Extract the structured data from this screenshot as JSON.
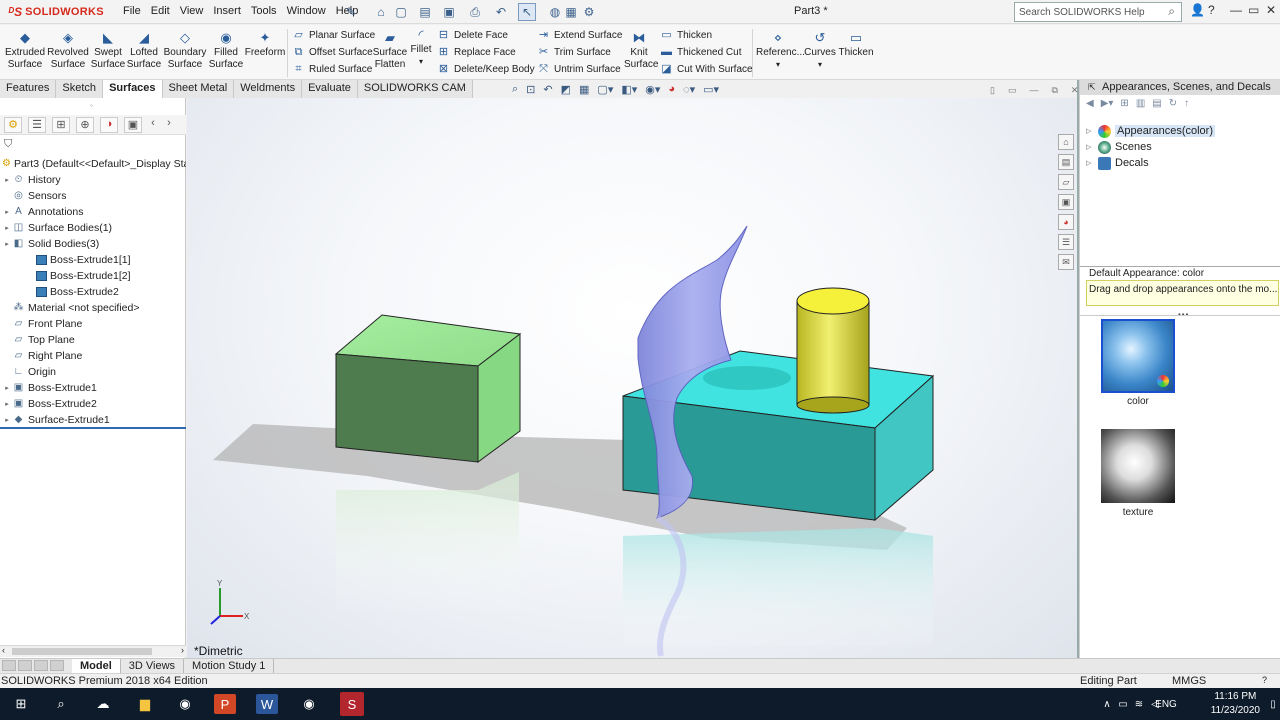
{
  "app": {
    "brand": "SOLIDWORKS",
    "document_title": "Part3 *",
    "help_search_placeholder": "Search SOLIDWORKS Help"
  },
  "menus": [
    "File",
    "Edit",
    "View",
    "Insert",
    "Tools",
    "Window",
    "Help"
  ],
  "ribbon": {
    "big_buttons": [
      {
        "l1": "Extruded",
        "l2": "Surface",
        "icon": "extruded-surface-icon"
      },
      {
        "l1": "Revolved",
        "l2": "Surface",
        "icon": "revolved-surface-icon"
      },
      {
        "l1": "Swept",
        "l2": "Surface",
        "icon": "swept-surface-icon"
      },
      {
        "l1": "Lofted",
        "l2": "Surface",
        "icon": "lofted-surface-icon"
      },
      {
        "l1": "Boundary",
        "l2": "Surface",
        "icon": "boundary-surface-icon"
      },
      {
        "l1": "Filled",
        "l2": "Surface",
        "icon": "filled-surface-icon"
      },
      {
        "l1": "Freeform",
        "l2": "",
        "icon": "freeform-icon"
      }
    ],
    "col1": [
      "Planar Surface",
      "Offset Surface",
      "Ruled Surface"
    ],
    "surface_flatten": {
      "l1": "Surface",
      "l2": "Flatten"
    },
    "fillet": "Fillet",
    "col2": [
      "Delete Face",
      "Replace Face",
      "Delete/Keep Body"
    ],
    "col3": [
      "Extend Surface",
      "Trim Surface",
      "Untrim Surface"
    ],
    "knit": {
      "l1": "Knit",
      "l2": "Surface"
    },
    "col4": [
      "Thicken",
      "Thickened Cut",
      "Cut With Surface"
    ],
    "reference": "Referenc...",
    "curves": "Curves",
    "thicken_big": "Thicken"
  },
  "tabs": [
    "Features",
    "Sketch",
    "Surfaces",
    "Sheet Metal",
    "Weldments",
    "Evaluate",
    "SOLIDWORKS CAM"
  ],
  "active_tab": "Surfaces",
  "tree": {
    "root": "Part3  (Default<<Default>_Display Sta",
    "items": [
      {
        "label": "History",
        "icon": "history-icon",
        "expand": true,
        "indent": 0
      },
      {
        "label": "Sensors",
        "icon": "sensors-icon",
        "expand": false,
        "indent": 0
      },
      {
        "label": "Annotations",
        "icon": "annotations-icon",
        "expand": true,
        "indent": 0
      },
      {
        "label": "Surface Bodies(1)",
        "icon": "surface-bodies-icon",
        "expand": true,
        "indent": 0
      },
      {
        "label": "Solid Bodies(3)",
        "icon": "solid-bodies-icon",
        "expand": true,
        "indent": 0
      },
      {
        "label": "Boss-Extrude1[1]",
        "icon": "solid-body-icon",
        "expand": false,
        "indent": 1
      },
      {
        "label": "Boss-Extrude1[2]",
        "icon": "solid-body-icon",
        "expand": false,
        "indent": 1
      },
      {
        "label": "Boss-Extrude2",
        "icon": "solid-body-icon",
        "expand": false,
        "indent": 1
      },
      {
        "label": "Material <not specified>",
        "icon": "material-icon",
        "expand": false,
        "indent": 0
      },
      {
        "label": "Front Plane",
        "icon": "plane-icon",
        "expand": false,
        "indent": 0
      },
      {
        "label": "Top Plane",
        "icon": "plane-icon",
        "expand": false,
        "indent": 0
      },
      {
        "label": "Right Plane",
        "icon": "plane-icon",
        "expand": false,
        "indent": 0
      },
      {
        "label": "Origin",
        "icon": "origin-icon",
        "expand": false,
        "indent": 0
      },
      {
        "label": "Boss-Extrude1",
        "icon": "boss-extrude-icon",
        "expand": true,
        "indent": 0
      },
      {
        "label": "Boss-Extrude2",
        "icon": "boss-extrude-icon",
        "expand": true,
        "indent": 0
      },
      {
        "label": "Surface-Extrude1",
        "icon": "surface-extrude-icon",
        "expand": true,
        "indent": 0
      }
    ]
  },
  "viewport": {
    "view_label": "*Dimetric",
    "triad": {
      "x": "X",
      "y": "Y"
    }
  },
  "bottom_tabs": [
    "Model",
    "3D Views",
    "Motion Study 1"
  ],
  "active_bottom_tab": "Model",
  "status": {
    "left": "SOLIDWORKS Premium 2018 x64 Edition",
    "mode": "Editing Part",
    "units": "MMGS"
  },
  "right_panel": {
    "title": "Appearances, Scenes, and Decals",
    "tree": [
      {
        "label": "Appearances(color)",
        "selected": true,
        "icon": "appearances-icon"
      },
      {
        "label": "Scenes",
        "selected": false,
        "icon": "scenes-icon"
      },
      {
        "label": "Decals",
        "selected": false,
        "icon": "decals-icon"
      }
    ],
    "default_appearance": "Default Appearance: color",
    "tip": "Drag and drop appearances onto the mo...",
    "swatches": [
      {
        "label": "color",
        "icon": "color-swatch-icon"
      },
      {
        "label": "texture",
        "icon": "texture-swatch-icon"
      }
    ]
  },
  "taskbar": {
    "lang": "ENG",
    "time": "11:16 PM",
    "date": "11/23/2020"
  },
  "colors": {
    "accent": "#2e6ab0",
    "green_box": "#4e7a4e",
    "teal_box": "#2a9a96",
    "cylinder": "#d8d640",
    "surface": "#8a90e0",
    "brand": "#d52b1e"
  }
}
